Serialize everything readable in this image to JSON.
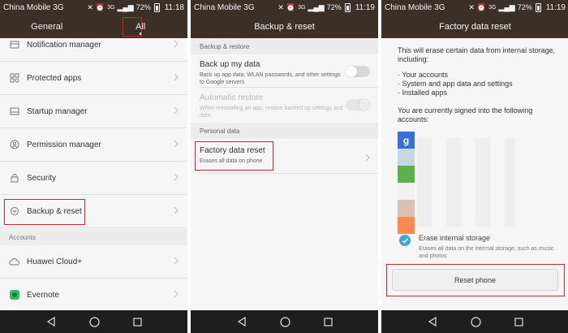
{
  "status": {
    "carrier": "China Mobile 3G",
    "battery": "72%",
    "time1": "11:18",
    "time2": "11:19",
    "time3": "11:19",
    "signal_label": "3G"
  },
  "screen1": {
    "tabs": [
      {
        "label": "General"
      },
      {
        "label": "All"
      }
    ],
    "items": [
      {
        "label": "Notification manager",
        "icon": "notification-icon"
      },
      {
        "label": "Protected apps",
        "icon": "protected-apps-icon"
      },
      {
        "label": "Startup manager",
        "icon": "startup-icon"
      },
      {
        "label": "Permission manager",
        "icon": "permission-icon"
      },
      {
        "label": "Security",
        "icon": "lock-icon"
      },
      {
        "label": "Backup & reset",
        "icon": "backup-icon"
      }
    ],
    "section_accounts": "Accounts",
    "accounts": [
      {
        "label": "Huawei Cloud+",
        "icon": "cloud-icon"
      },
      {
        "label": "Evernote",
        "icon": "evernote-icon"
      }
    ]
  },
  "screen2": {
    "title": "Backup & reset",
    "section_backup": "Backup & restore",
    "backup_title": "Back up my data",
    "backup_desc": "Back up app data, WLAN passwords, and other settings to Google servers",
    "auto_title": "Automatic restore",
    "auto_desc": "When reinstalling an app, restore backed up settings and data",
    "section_personal": "Personal data",
    "factory_title": "Factory data reset",
    "factory_desc": "Erases all data on phone"
  },
  "screen3": {
    "title": "Factory data reset",
    "intro": "This will erase certain data from internal storage, including:",
    "bullet1": "· Your accounts",
    "bullet2": "· System and app data and settings",
    "bullet3": "· Installed apps",
    "signed_in": "You are currently signed into the following accounts:",
    "erase_title": "Erase internal storage",
    "erase_desc": "Erases all data on the internal storage, such as music and photos",
    "reset_button": "Reset phone",
    "account_colors": [
      "#3a6fd8",
      "#c9d7e4",
      "#5cb24a",
      "#f1f1f1",
      "#d9c3b0",
      "#ff8a50"
    ]
  },
  "colors": {
    "header": "#3c3026",
    "navbar": "#1e1e1e",
    "highlight": "#c8262c",
    "check": "#45a9c7"
  }
}
